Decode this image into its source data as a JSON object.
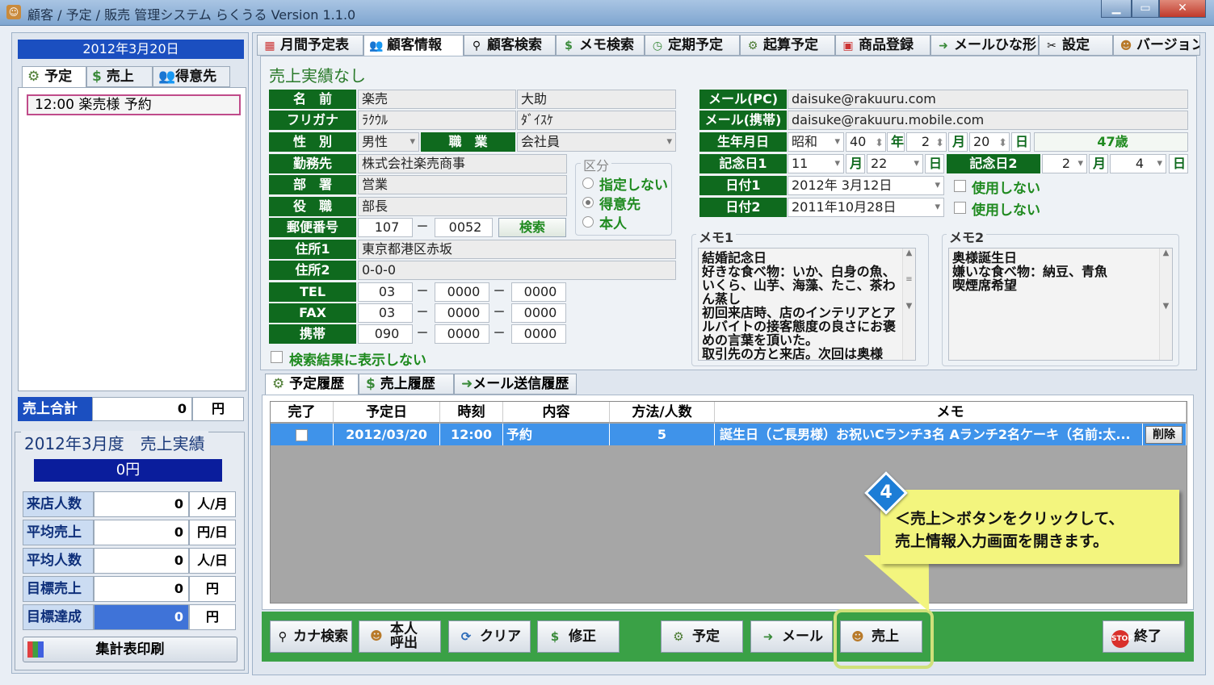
{
  "window": {
    "title": "顧客 / 予定 / 販売 管理システム らくうる  Version 1.1.0",
    "minimize": "▁",
    "maximize": "▭",
    "close": "✕"
  },
  "left": {
    "date_header": "2012年3月20日",
    "tabs": [
      {
        "label": "予定",
        "icon": "calendar-icon"
      },
      {
        "label": "売上",
        "icon": "money-bag-icon"
      },
      {
        "label": "得意先",
        "icon": "people-icon"
      }
    ],
    "appointments": [
      "12:00 楽売様 予約"
    ],
    "sales_total": {
      "label": "売上合計",
      "value": "0",
      "unit": "円"
    },
    "monthly": {
      "title": "2012年3月度　売上実績",
      "amount": "0円",
      "stats": [
        {
          "label": "来店人数",
          "value": "0",
          "unit": "人/月"
        },
        {
          "label": "平均売上",
          "value": "0",
          "unit": "円/日"
        },
        {
          "label": "平均人数",
          "value": "0",
          "unit": "人/日"
        },
        {
          "label": "目標売上",
          "value": "0",
          "unit": "円"
        },
        {
          "label": "目標達成",
          "value": "0",
          "unit": "円"
        }
      ]
    },
    "print_button": "集計表印刷"
  },
  "tabs": [
    {
      "label": "月間予定表",
      "icon": "calendar-30-icon"
    },
    {
      "label": "顧客情報",
      "icon": "people-icon"
    },
    {
      "label": "顧客検索",
      "icon": "magnifier-icon"
    },
    {
      "label": "メモ検索",
      "icon": "money-bag-icon"
    },
    {
      "label": "定期予定",
      "icon": "clock-icon"
    },
    {
      "label": "起算予定",
      "icon": "calendar-icon"
    },
    {
      "label": "商品登録",
      "icon": "gift-icon"
    },
    {
      "label": "メールひな形",
      "icon": "mail-icon"
    },
    {
      "label": "設定",
      "icon": "tools-icon"
    },
    {
      "label": "バージョン",
      "icon": "person-icon"
    }
  ],
  "customer": {
    "status_title": "売上実績なし",
    "labels": {
      "name": "名　前",
      "furigana": "フリガナ",
      "gender": "性　別",
      "job": "職　業",
      "company": "勤務先",
      "dept": "部　署",
      "position": "役　職",
      "zip": "郵便番号",
      "addr1": "住所1",
      "addr2": "住所2",
      "tel": "TEL",
      "fax": "FAX",
      "mobile": "携帯"
    },
    "last_name": "楽売",
    "first_name": "大助",
    "furigana_last": "ﾗｸｳﾙ",
    "furigana_first": "ﾀﾞｲｽｹ",
    "gender": "男性",
    "job": "会社員",
    "company": "株式会社楽売商事",
    "dept": "営業",
    "position": "部長",
    "zip1": "107",
    "zip2": "0052",
    "search_button": "検索",
    "addr1": "東京都港区赤坂",
    "addr2": "0-0-0",
    "tel": [
      "03",
      "0000",
      "0000"
    ],
    "fax": [
      "03",
      "0000",
      "0000"
    ],
    "mobile": [
      "090",
      "0000",
      "0000"
    ],
    "dash": "－",
    "hide_in_search": "検索結果に表示しない",
    "kubun": {
      "title": "区分",
      "options": [
        "指定しない",
        "得意先",
        "本人"
      ],
      "selected": "得意先"
    },
    "right_labels": {
      "mail_pc": "メール(PC)",
      "mail_mobile": "メール(携帯)",
      "birthday": "生年月日",
      "anniv1": "記念日1",
      "anniv2": "記念日2",
      "date1": "日付1",
      "date2": "日付2"
    },
    "mail_pc": "daisuke@rakuuru.com",
    "mail_mobile": "daisuke@rakuuru.mobile.com",
    "birth_era": "昭和",
    "birth_year": "40",
    "birth_month": "2",
    "birth_day": "20",
    "age": "47歳",
    "year_unit": "年",
    "month_unit": "月",
    "day_unit": "日",
    "anniv1_month": "11",
    "anniv1_day": "22",
    "anniv2_month": "2",
    "anniv2_day": "4",
    "date1": "2012年 3月12日",
    "date2": "2011年10月28日",
    "not_used": "使用しない",
    "memo1_title": "メモ1",
    "memo1": "結婚記念日\n好きな食べ物：いか、白身の魚、いくら、山芋、海藻、たこ、茶わん蒸し\n初回来店時、店のインテリアとアルバイトの接客態度の良さにお褒めの言葉を頂いた。\n取引先の方と来店。次回は奥様",
    "memo2_title": "メモ2",
    "memo2": "奥様誕生日\n嫌いな食べ物：納豆、青魚\n喫煙席希望"
  },
  "history": {
    "tabs": [
      {
        "label": "予定履歴",
        "icon": "calendar-icon"
      },
      {
        "label": "売上履歴",
        "icon": "money-bag-icon"
      },
      {
        "label": "メール送信履歴",
        "icon": "mail-icon"
      }
    ],
    "columns": [
      "完了",
      "予定日",
      "時刻",
      "内容",
      "方法/人数",
      "メモ"
    ],
    "rows": [
      {
        "date": "2012/03/20",
        "time": "12:00",
        "content": "予約",
        "people": "5",
        "memo": "誕生日（ご長男様）お祝いCランチ3名 Aランチ2名ケーキ（名前:太...",
        "delete": "削除"
      }
    ]
  },
  "buttons": [
    {
      "label": "カナ検索",
      "icon": "magnifier-icon"
    },
    {
      "label": "本人\n呼出",
      "icon": "person-icon"
    },
    {
      "label": "クリア",
      "icon": "refresh-icon"
    },
    {
      "label": "修正",
      "icon": "money-bag-icon"
    },
    {
      "label": "予定",
      "icon": "calendar-icon"
    },
    {
      "label": "メール",
      "icon": "mail-icon"
    },
    {
      "label": "売上",
      "icon": "person-icon"
    },
    {
      "label": "終了",
      "icon": "stop-icon"
    }
  ],
  "callout": {
    "step": "4",
    "line1": "＜売上＞ボタンをクリックして、",
    "line2": "売上情報入力画面を開きます。"
  },
  "colors": {
    "accent_green": "#0f6a1e",
    "header_blue": "#1b4fc0",
    "callout_yellow": "#f3f57e",
    "row_highlight": "#3f93ea"
  }
}
